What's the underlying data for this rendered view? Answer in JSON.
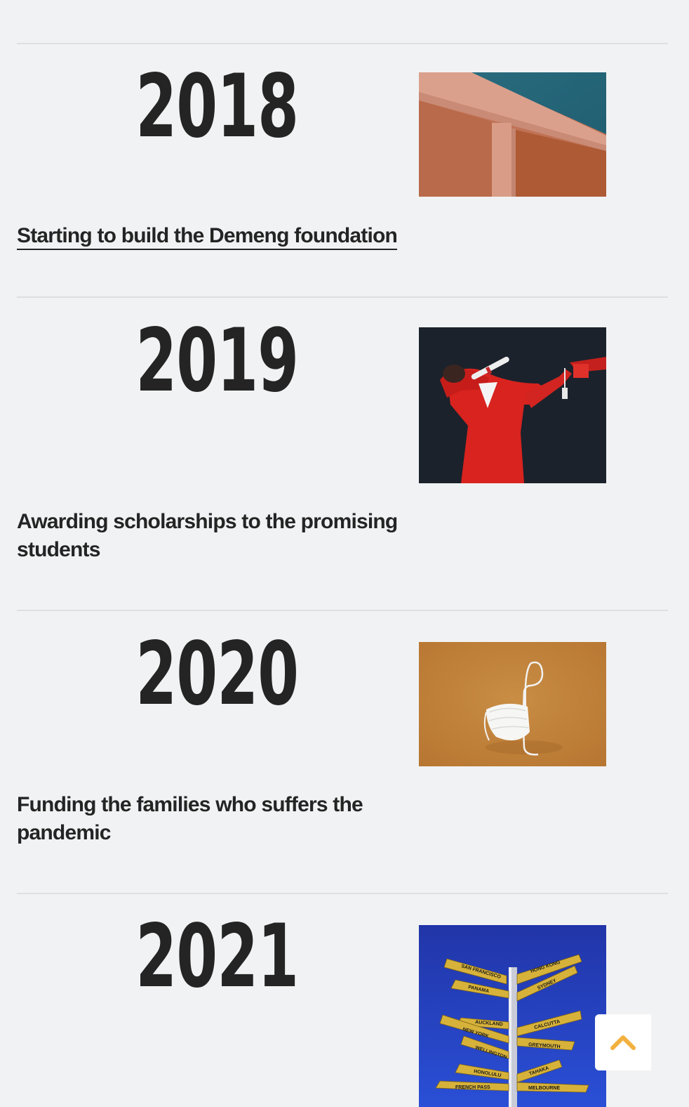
{
  "timeline": [
    {
      "year": "2018",
      "description": "Starting to build the Demeng foundation",
      "image": "pink-arch-building-against-teal-sky"
    },
    {
      "year": "2019",
      "description": "Awarding scholarships to the promising students",
      "image": "graduate-in-red-gown-dabbing-with-cap-and-diploma"
    },
    {
      "year": "2020",
      "description": "Funding the families who suffers the pandemic",
      "image": "white-face-mask-on-orange-background"
    },
    {
      "year": "2021",
      "description": "",
      "image": "yellow-city-direction-signpost-against-blue-sky",
      "signpost_labels": [
        "SAN FRANCISCO",
        "HONG KONG",
        "PANAMA",
        "SYDNEY",
        "AUCKLAND",
        "CALCUTTA",
        "NEW YORK",
        "GREYMOUTH",
        "WELLINGTON",
        "HONOLULU",
        "TAHAKA",
        "FRENCH PASS",
        "MELBOURNE"
      ]
    }
  ],
  "scroll_top": {
    "icon": "chevron-up-icon"
  },
  "colors": {
    "background": "#f1f2f3",
    "text": "#242424",
    "divider": "#dddfe1",
    "accent": "#f2b13f"
  }
}
